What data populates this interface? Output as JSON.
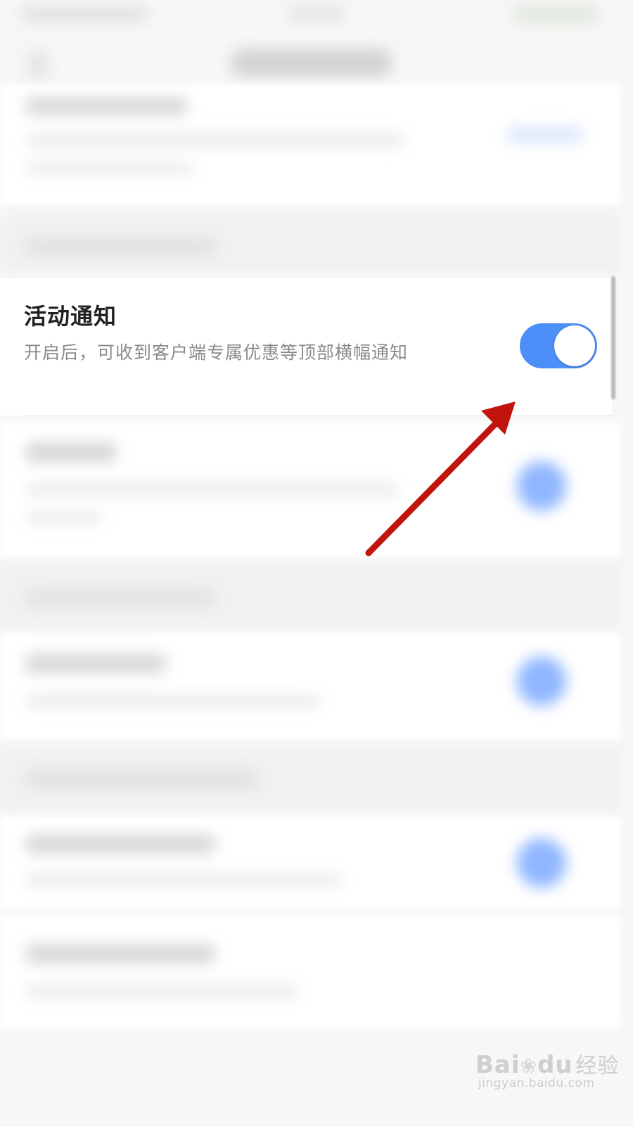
{
  "settings": {
    "activity_notification": {
      "title": "活动通知",
      "description": "开启后，可收到客户端专属优惠等顶部横幅通知",
      "enabled": true
    }
  },
  "colors": {
    "toggle_on": "#4d8ff8",
    "annotation_arrow": "#c0140d"
  },
  "watermark": {
    "logo": "Bai",
    "logo_tail": "du",
    "logo_cn": "经验",
    "url": "jingyan.baidu.com"
  }
}
